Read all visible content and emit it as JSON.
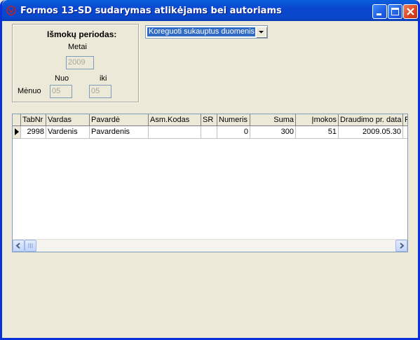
{
  "window": {
    "title": "Formos 13-SD sudarymas atlikėjams bei autoriams"
  },
  "period": {
    "heading": "Išmokų periodas:",
    "year_label": "Metai",
    "year_value": "2009",
    "from_label": "Nuo",
    "to_label": "iki",
    "month_label": "Mėnuo",
    "month_from": "05",
    "month_to": "05"
  },
  "mode_select": {
    "value": "Koreguoti sukauptus duomenis"
  },
  "table": {
    "columns": [
      "TabNr",
      "Vardas",
      "Pavardė",
      "Asm.Kodas",
      "SR",
      "Numeris",
      "Suma",
      "Įmokos",
      "Draudimo pr. data",
      "P"
    ],
    "rows": [
      [
        "2998",
        "Vardenis",
        "Pavardenis",
        "",
        "",
        "0",
        "300",
        "51",
        "2009.05.30",
        ""
      ]
    ]
  }
}
